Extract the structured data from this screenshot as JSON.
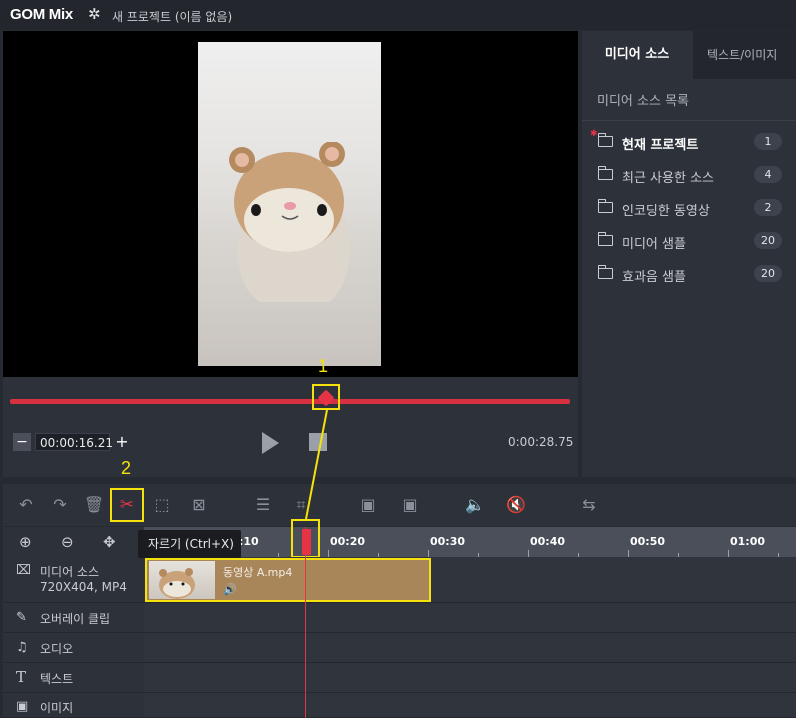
{
  "app": {
    "logo": "GOM Mix",
    "project_title": "새 프로젝트 (이름 없음)"
  },
  "player": {
    "current_time": "00:00:16.21",
    "total_time": "0:00:28.75",
    "minus": "−",
    "plus": "+",
    "progress_fraction": 0.565
  },
  "right_panel": {
    "tabs": [
      {
        "label": "미디어 소스",
        "active": true
      },
      {
        "label": "텍스트/이미지",
        "active": false
      }
    ],
    "list_title": "미디어 소스 목록",
    "sources": [
      {
        "label": "현재 프로젝트",
        "count": "1",
        "current": true
      },
      {
        "label": "최근 사용한 소스",
        "count": "4",
        "current": false
      },
      {
        "label": "인코딩한 동영상",
        "count": "2",
        "current": false
      },
      {
        "label": "미디어 샘플",
        "count": "20",
        "current": false
      },
      {
        "label": "효과음 샘플",
        "count": "20",
        "current": false
      }
    ]
  },
  "toolbar": {
    "cut_tooltip": "자르기 (Ctrl+X)"
  },
  "annotations": {
    "marker1": "1",
    "marker2": "2"
  },
  "timeline": {
    "ruler_labels": [
      ":10",
      "00:20",
      "00:30",
      "00:40",
      "00:50",
      "01:00"
    ],
    "tracks": {
      "media_label": "미디어 소스",
      "media_sub": "720X404, MP4",
      "overlay_label": "오버레이 클립",
      "audio_label": "오디오",
      "text_label": "텍스트",
      "image_label": "이미지"
    },
    "clip": {
      "name": "동영상 A.mp4",
      "audio_icon": "speaker-icon"
    }
  },
  "colors": {
    "accent": "#e63446",
    "highlight": "#f5e20c",
    "clip": "#a88659"
  }
}
